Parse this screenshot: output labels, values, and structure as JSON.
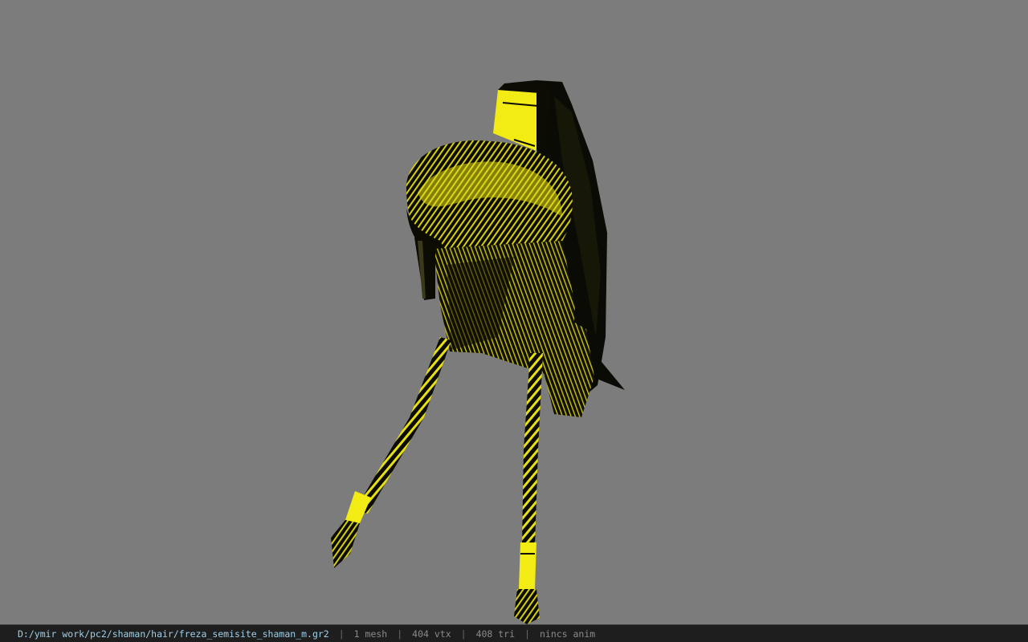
{
  "viewport": {
    "background": "#7c7c7c",
    "model_colors": {
      "yellow": "#f2ec14",
      "dark": "#0c0c04"
    }
  },
  "status": {
    "path": "D:/ymir work/pc2/shaman/hair/freza_semisite_shaman_m.gr2",
    "sep": "|",
    "meshes": "1 mesh",
    "vertices": "404 vtx",
    "triangles": "408 tri",
    "anim": "nincs anim"
  }
}
